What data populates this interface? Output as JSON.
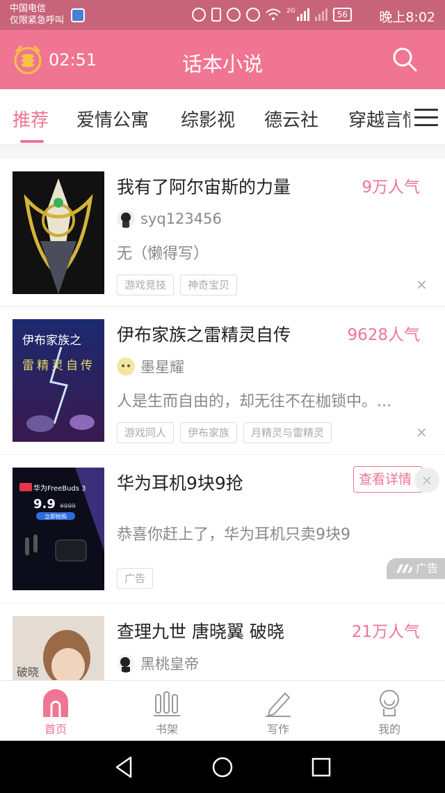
{
  "status_bar": {
    "carrier": "中国电信",
    "emergency": "仅限紧急呼叫",
    "network": "2G",
    "battery": "56",
    "time": "晚上8:02"
  },
  "header": {
    "timer": "02:51",
    "title": "话本小说",
    "icons": [
      "alarm-coin-icon",
      "search-icon"
    ]
  },
  "tabs": [
    {
      "label": "推荐",
      "active": true
    },
    {
      "label": "爱情公寓"
    },
    {
      "label": "综影视"
    },
    {
      "label": "德云社"
    },
    {
      "label": "穿越言情"
    }
  ],
  "books": [
    {
      "title": "我有了阿尔宙斯的力量",
      "popularity": "9万人气",
      "author": "syq123456",
      "description": "无（懒得写）",
      "tags": [
        "游戏竞技",
        "神奇宝贝"
      ]
    },
    {
      "title": "伊布家族之雷精灵自传",
      "popularity": "9628人气",
      "author": "墨星耀",
      "description": "人是生而自由的，却无往不在枷锁中。...",
      "tags": [
        "游戏同人",
        "伊布家族",
        "月精灵与雷精灵"
      ],
      "cover_text": [
        "伊布家族之",
        "雷精灵自传"
      ]
    }
  ],
  "ad": {
    "title": "华为耳机9块9抢",
    "description": "恭喜你赶上了，华为耳机只卖9块9",
    "tag": "广告",
    "button": "查看详情",
    "badge": "广告",
    "cover_text": {
      "brand": "华为FreeBuds 3",
      "price": "9.9",
      "old_price": "¥999",
      "cta": "立即抢购"
    }
  },
  "partial_book": {
    "title": "查理九世 唐晓翼 破晓",
    "popularity": "21万人气",
    "author": "黑桃皇帝",
    "cover_text": "破晓"
  },
  "close_symbol": "×",
  "bottom_nav": [
    {
      "label": "首页",
      "icon": "home-icon",
      "active": true
    },
    {
      "label": "书架",
      "icon": "bookshelf-icon"
    },
    {
      "label": "写作",
      "icon": "pencil-icon"
    },
    {
      "label": "我的",
      "icon": "profile-icon"
    }
  ],
  "colors": {
    "accent": "#f07592",
    "status_bar": "#c8647a",
    "muted_text": "#888888"
  }
}
